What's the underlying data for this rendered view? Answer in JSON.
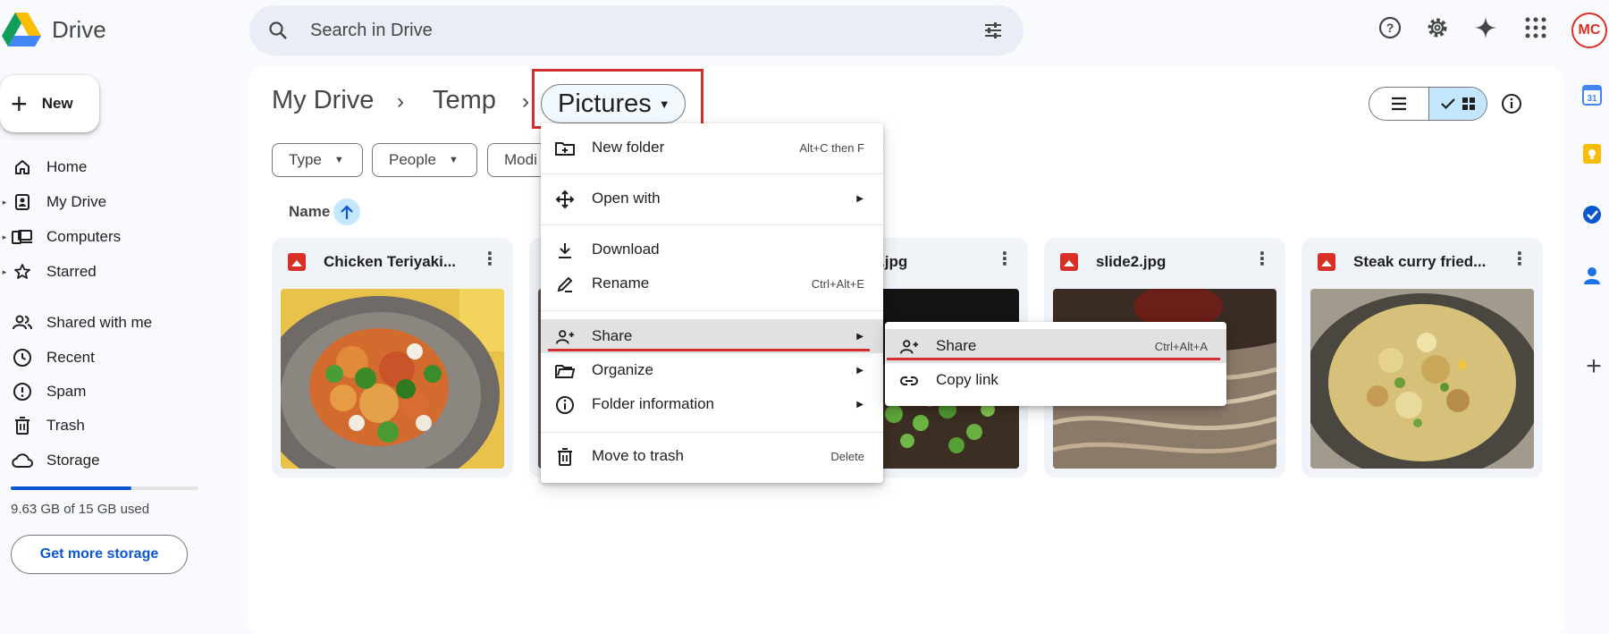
{
  "app": {
    "name": "Drive"
  },
  "search": {
    "placeholder": "Search in Drive"
  },
  "avatar": {
    "text": "MC"
  },
  "sidebar": {
    "new_label": "New",
    "items": [
      {
        "label": "Home",
        "icon": "home-icon"
      },
      {
        "label": "My Drive",
        "icon": "my-drive-icon"
      },
      {
        "label": "Computers",
        "icon": "computers-icon"
      },
      {
        "label": "Starred",
        "icon": "star-icon"
      },
      {
        "label": "Shared with me",
        "icon": "people-icon"
      },
      {
        "label": "Recent",
        "icon": "clock-icon"
      },
      {
        "label": "Spam",
        "icon": "spam-icon"
      },
      {
        "label": "Trash",
        "icon": "trash-icon"
      },
      {
        "label": "Storage",
        "icon": "cloud-icon"
      }
    ],
    "storage_used": 0.642,
    "storage_text": "9.63 GB of 15 GB used",
    "get_storage": "Get more storage"
  },
  "breadcrumb": {
    "root": "My Drive",
    "parent": "Temp",
    "current": "Pictures"
  },
  "filters": {
    "type": "Type",
    "people": "People",
    "modified": "Modi"
  },
  "list_header": {
    "name": "Name"
  },
  "files": [
    {
      "name": "Chicken Teriyaki...",
      "photo": "chicken-teriyaki"
    },
    {
      "name": "",
      "photo": "hidden"
    },
    {
      "name": ".jpg",
      "photo": "noodles-greens"
    },
    {
      "name": "slide2.jpg",
      "photo": "noodles"
    },
    {
      "name": "Steak curry fried...",
      "photo": "fried-rice"
    }
  ],
  "context_menu": {
    "new_folder": "New folder",
    "new_folder_shortcut": "Alt+C then F",
    "open_with": "Open with",
    "download": "Download",
    "rename": "Rename",
    "rename_shortcut": "Ctrl+Alt+E",
    "share": "Share",
    "organize": "Organize",
    "folder_info": "Folder information",
    "move_to_trash": "Move to trash",
    "trash_shortcut": "Delete"
  },
  "share_submenu": {
    "share": "Share",
    "share_shortcut": "Ctrl+Alt+A",
    "copy_link": "Copy link"
  },
  "colors": {
    "accent": "#0b57d0",
    "highlight": "#d32f2f",
    "selected": "#c2e7ff"
  }
}
